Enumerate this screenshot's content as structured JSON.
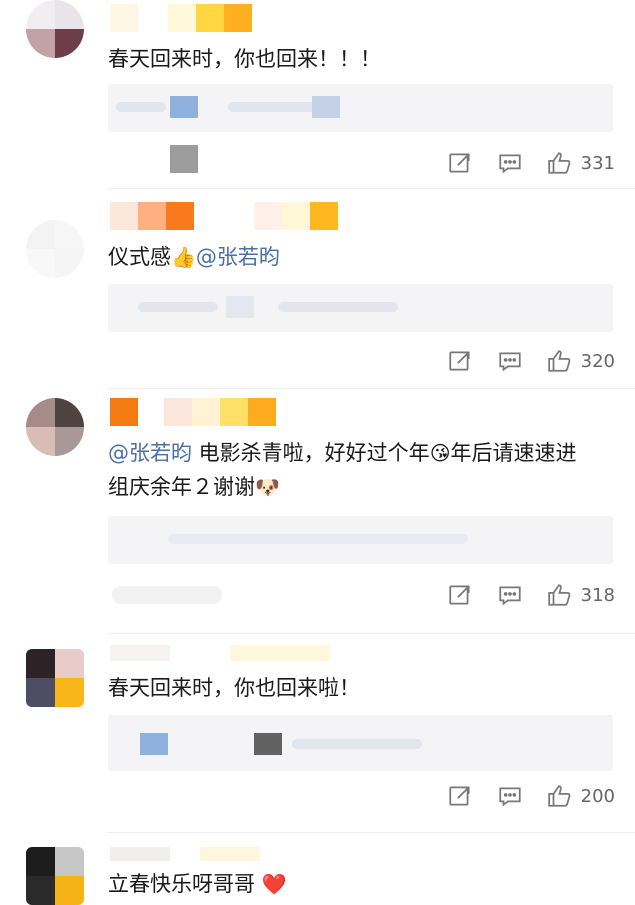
{
  "comments": [
    {
      "text": "春天回来时，你也回来！！！",
      "likes": "331"
    },
    {
      "text_before": "仪式感",
      "emoji_thumb": "👍",
      "mention": "@张若昀",
      "likes": "320"
    },
    {
      "mention": "@张若昀",
      "text_a": " 电影杀青啦，好好过个年",
      "emoji_kiss": "😘",
      "text_b": "年后请速速进组庆余年２谢谢",
      "emoji_dog": "🐶",
      "likes": "318"
    },
    {
      "text": "春天回来时，你也回来啦！",
      "likes": "200"
    },
    {
      "text": "立春快乐呀哥哥",
      "emoji_heart": "❤️"
    }
  ],
  "icons": {
    "share": "share-icon",
    "reply": "comment-icon",
    "like": "thumbs-up-icon"
  },
  "colors": {
    "mention": "#4a6fa5",
    "reply_bg": "#f4f4f6",
    "text": "#1a1a1a",
    "action": "#777777"
  }
}
